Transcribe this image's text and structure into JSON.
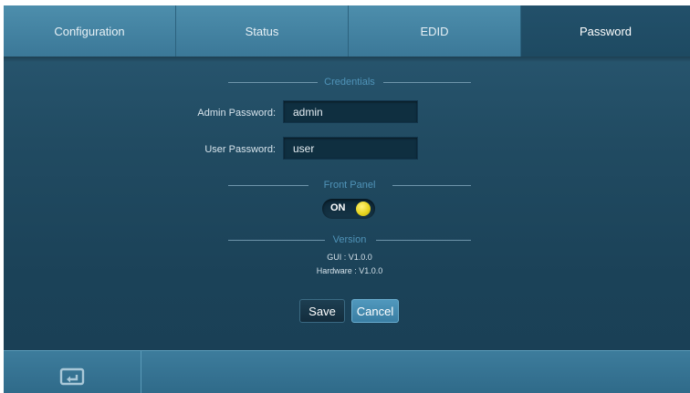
{
  "tabs": [
    {
      "label": "Configuration"
    },
    {
      "label": "Status"
    },
    {
      "label": "EDID"
    },
    {
      "label": "Password"
    }
  ],
  "credentials": {
    "section_title": "Credentials",
    "admin_label": "Admin Password:",
    "admin_value": "admin",
    "user_label": "User Password:",
    "user_value": "user"
  },
  "front_panel": {
    "section_title": "Front Panel",
    "state": "ON"
  },
  "version": {
    "section_title": "Version",
    "gui": "GUI : V1.0.0",
    "hardware": "Hardware : V1.0.0"
  },
  "actions": {
    "save_label": "Save",
    "cancel_label": "Cancel"
  },
  "bottom_bar": {
    "icon": "return-icon"
  },
  "colors": {
    "accent": "#4f93b8",
    "tab_active": "#1e4a62",
    "tab_inactive": "#4285a6",
    "knob": "#e8d51f"
  }
}
